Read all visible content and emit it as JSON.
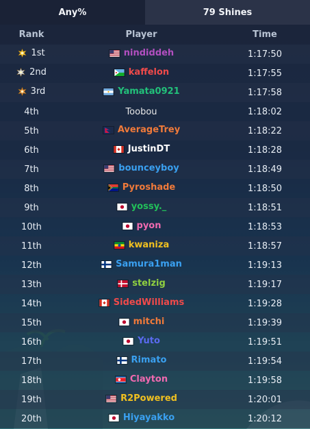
{
  "tabs": [
    {
      "label": "Any%",
      "active": true
    },
    {
      "label": "79 Shines",
      "active": false
    }
  ],
  "table": {
    "headers": {
      "rank": "Rank",
      "player": "Player",
      "time": "Time"
    },
    "rows": [
      {
        "rank": "1st",
        "medal": "gold-medal-icon",
        "flag": "usa",
        "player": "nindiddeh",
        "color": "#b24fc0",
        "time": "1:17:50"
      },
      {
        "rank": "2nd",
        "medal": "silver-medal-icon",
        "flag": "djibouti",
        "player": "kaffelon",
        "color": "#f04a4a",
        "time": "1:17:55"
      },
      {
        "rank": "3rd",
        "medal": "bronze-medal-icon",
        "flag": "argentina",
        "player": "Yamata0921",
        "color": "#22c07a",
        "time": "1:17:58"
      },
      {
        "rank": "4th",
        "flag": "",
        "player": "Toobou",
        "color": "#e8e8e8",
        "plain": true,
        "time": "1:18:02"
      },
      {
        "rank": "5th",
        "flag": "nepal",
        "player": "AverageTrey",
        "color": "#f07a3a",
        "time": "1:18:22"
      },
      {
        "rank": "6th",
        "flag": "canada",
        "player": "JustinDT",
        "color": "#ffffff",
        "time": "1:18:28"
      },
      {
        "rank": "7th",
        "flag": "usa",
        "player": "bounceyboy",
        "color": "#3aa0f0",
        "time": "1:18:49"
      },
      {
        "rank": "8th",
        "flag": "south-africa",
        "player": "Pyroshade",
        "color": "#f07a3a",
        "time": "1:18:50"
      },
      {
        "rank": "9th",
        "flag": "japan",
        "player": "yossy._",
        "color": "#22c05a",
        "time": "1:18:51"
      },
      {
        "rank": "10th",
        "flag": "japan",
        "player": "pyon",
        "color": "#f06ab0",
        "time": "1:18:53"
      },
      {
        "rank": "11th",
        "flag": "ethiopia",
        "player": "kwaniza",
        "color": "#f0c020",
        "time": "1:18:57"
      },
      {
        "rank": "12th",
        "flag": "finland",
        "player": "Samura1man",
        "color": "#3aa0f0",
        "time": "1:19:13"
      },
      {
        "rank": "13th",
        "flag": "denmark",
        "player": "stelzig",
        "color": "#90d040",
        "time": "1:19:17"
      },
      {
        "rank": "14th",
        "flag": "canada",
        "player": "SidedWilliams",
        "color": "#f04a4a",
        "time": "1:19:28"
      },
      {
        "rank": "15th",
        "flag": "japan",
        "player": "mitchi",
        "color": "#f07a3a",
        "time": "1:19:39"
      },
      {
        "rank": "16th",
        "flag": "japan",
        "player": "Yuto",
        "color": "#5a6af0",
        "time": "1:19:51"
      },
      {
        "rank": "17th",
        "flag": "finland",
        "player": "Rimato",
        "color": "#3aa0f0",
        "time": "1:19:54"
      },
      {
        "rank": "18th",
        "flag": "north-korea",
        "player": "Clayton",
        "color": "#f06ab0",
        "time": "1:19:58"
      },
      {
        "rank": "19th",
        "flag": "usa",
        "player": "R2Powered",
        "color": "#f0c020",
        "time": "1:20:01"
      },
      {
        "rank": "20th",
        "flag": "japan",
        "player": "Hiyayakko",
        "color": "#3aa0f0",
        "time": "1:20:12"
      }
    ]
  }
}
